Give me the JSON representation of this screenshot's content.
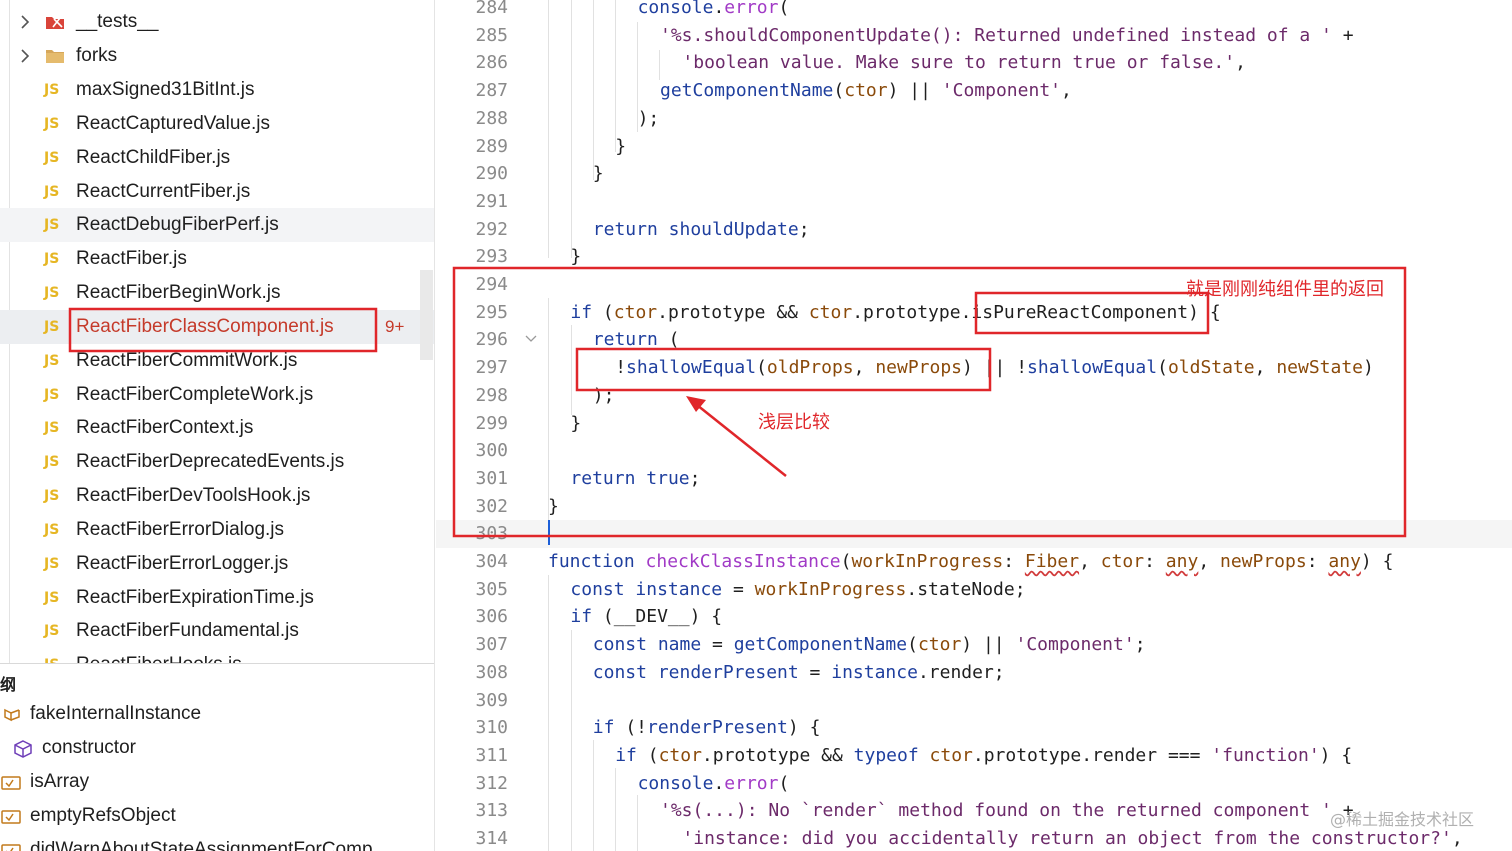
{
  "explorer": {
    "items": [
      {
        "kind": "folder",
        "label": "__tests__",
        "icon": "test-folder-icon"
      },
      {
        "kind": "folder",
        "label": "forks",
        "icon": "folder-icon"
      },
      {
        "kind": "file",
        "label": "maxSigned31BitInt.js"
      },
      {
        "kind": "file",
        "label": "ReactCapturedValue.js"
      },
      {
        "kind": "file",
        "label": "ReactChildFiber.js"
      },
      {
        "kind": "file",
        "label": "ReactCurrentFiber.js"
      },
      {
        "kind": "file",
        "label": "ReactDebugFiberPerf.js"
      },
      {
        "kind": "file",
        "label": "ReactFiber.js"
      },
      {
        "kind": "file",
        "label": "ReactFiberBeginWork.js"
      },
      {
        "kind": "file",
        "label": "ReactFiberClassComponent.js",
        "badge": "9+",
        "selected": true
      },
      {
        "kind": "file",
        "label": "ReactFiberCommitWork.js"
      },
      {
        "kind": "file",
        "label": "ReactFiberCompleteWork.js"
      },
      {
        "kind": "file",
        "label": "ReactFiberContext.js"
      },
      {
        "kind": "file",
        "label": "ReactFiberDeprecatedEvents.js"
      },
      {
        "kind": "file",
        "label": "ReactFiberDevToolsHook.js"
      },
      {
        "kind": "file",
        "label": "ReactFiberErrorDialog.js"
      },
      {
        "kind": "file",
        "label": "ReactFiberErrorLogger.js"
      },
      {
        "kind": "file",
        "label": "ReactFiberExpirationTime.js"
      },
      {
        "kind": "file",
        "label": "ReactFiberFundamental.js"
      },
      {
        "kind": "file",
        "label": "ReactFiberHooks.js"
      }
    ],
    "js_icon_text": "JS",
    "js_icon_color": "#e6b624",
    "modified_color": "#c53a2a"
  },
  "outline": {
    "title": "纲",
    "items": [
      {
        "label": "fakeInternalInstance",
        "icon": "variable-icon"
      },
      {
        "label": "constructor",
        "icon": "method-cube-icon"
      },
      {
        "label": "isArray",
        "icon": "field-icon"
      },
      {
        "label": "emptyRefsObject",
        "icon": "field-icon"
      },
      {
        "label": "didWarnAboutStateAssignmentForComp",
        "icon": "field-icon"
      }
    ]
  },
  "editor": {
    "current_line": 303,
    "lines": [
      {
        "n": "284",
        "indent": 4,
        "tokens": [
          [
            "f",
            "console"
          ],
          [
            "o",
            "."
          ],
          [
            "fn",
            "error"
          ],
          [
            "o",
            "("
          ]
        ]
      },
      {
        "n": "285",
        "indent": 5,
        "tokens": [
          [
            "s",
            "'%s.shouldComponentUpdate(): Returned undefined instead of a '"
          ],
          [
            "o",
            " +"
          ]
        ]
      },
      {
        "n": "286",
        "indent": 6,
        "tokens": [
          [
            "s",
            "'boolean value. Make sure to return true or false.'"
          ],
          [
            "o",
            ","
          ]
        ]
      },
      {
        "n": "287",
        "indent": 5,
        "tokens": [
          [
            "f",
            "getComponentName"
          ],
          [
            "o",
            "("
          ],
          [
            "p",
            "ctor"
          ],
          [
            "o",
            ") || "
          ],
          [
            "s",
            "'Component'"
          ],
          [
            "o",
            ","
          ]
        ]
      },
      {
        "n": "288",
        "indent": 4,
        "tokens": [
          [
            "o",
            ");"
          ]
        ]
      },
      {
        "n": "289",
        "indent": 3,
        "tokens": [
          [
            "o",
            "}"
          ]
        ]
      },
      {
        "n": "290",
        "indent": 2,
        "tokens": [
          [
            "o",
            "}"
          ]
        ]
      },
      {
        "n": "291",
        "indent": 0,
        "tokens": []
      },
      {
        "n": "292",
        "indent": 2,
        "tokens": [
          [
            "k",
            "return"
          ],
          [
            "o",
            " "
          ],
          [
            "v",
            "shouldUpdate"
          ],
          [
            "o",
            ";"
          ]
        ]
      },
      {
        "n": "293",
        "indent": 1,
        "tokens": [
          [
            "o",
            "}"
          ]
        ]
      },
      {
        "n": "294",
        "indent": 0,
        "tokens": []
      },
      {
        "n": "295",
        "indent": 1,
        "tokens": [
          [
            "k",
            "if"
          ],
          [
            "o",
            " ("
          ],
          [
            "p",
            "ctor"
          ],
          [
            "o",
            ".prototype && "
          ],
          [
            "p",
            "ctor"
          ],
          [
            "o",
            ".prototype.isPureReactComponent) {"
          ]
        ]
      },
      {
        "n": "296",
        "indent": 2,
        "fold": true,
        "tokens": [
          [
            "k",
            "return"
          ],
          [
            "o",
            " ("
          ]
        ]
      },
      {
        "n": "297",
        "indent": 3,
        "tokens": [
          [
            "o",
            "!"
          ],
          [
            "f",
            "shallowEqual"
          ],
          [
            "o",
            "("
          ],
          [
            "p",
            "oldProps"
          ],
          [
            "o",
            ", "
          ],
          [
            "p",
            "newProps"
          ],
          [
            "o",
            ") || !"
          ],
          [
            "f",
            "shallowEqual"
          ],
          [
            "o",
            "("
          ],
          [
            "p",
            "oldState"
          ],
          [
            "o",
            ", "
          ],
          [
            "p",
            "newState"
          ],
          [
            "o",
            ")"
          ]
        ]
      },
      {
        "n": "298",
        "indent": 2,
        "tokens": [
          [
            "o",
            ");"
          ]
        ]
      },
      {
        "n": "299",
        "indent": 1,
        "tokens": [
          [
            "o",
            "}"
          ]
        ]
      },
      {
        "n": "300",
        "indent": 0,
        "tokens": []
      },
      {
        "n": "301",
        "indent": 1,
        "tokens": [
          [
            "k",
            "return"
          ],
          [
            "o",
            " "
          ],
          [
            "k",
            "true"
          ],
          [
            "o",
            ";"
          ]
        ]
      },
      {
        "n": "302",
        "indent": 0,
        "tokens": [
          [
            "o",
            "}"
          ]
        ]
      },
      {
        "n": "303",
        "indent": 0,
        "tokens": []
      },
      {
        "n": "304",
        "indent": 0,
        "tokens": [
          [
            "k",
            "function"
          ],
          [
            "o",
            " "
          ],
          [
            "fn",
            "checkClassInstance"
          ],
          [
            "o",
            "("
          ],
          [
            "p",
            "workInProgress"
          ],
          [
            "o",
            ": "
          ],
          [
            "t",
            "Fiber"
          ],
          [
            "o",
            ", "
          ],
          [
            "p",
            "ctor"
          ],
          [
            "o",
            ": "
          ],
          [
            "t",
            "any"
          ],
          [
            "o",
            ", "
          ],
          [
            "p",
            "newProps"
          ],
          [
            "o",
            ": "
          ],
          [
            "t",
            "any"
          ],
          [
            "o",
            ") {"
          ]
        ]
      },
      {
        "n": "305",
        "indent": 1,
        "tokens": [
          [
            "k",
            "const"
          ],
          [
            "o",
            " "
          ],
          [
            "v",
            "instance"
          ],
          [
            "o",
            " = "
          ],
          [
            "p",
            "workInProgress"
          ],
          [
            "o",
            ".stateNode;"
          ]
        ]
      },
      {
        "n": "306",
        "indent": 1,
        "tokens": [
          [
            "k",
            "if"
          ],
          [
            "o",
            " (__DEV__) {"
          ]
        ]
      },
      {
        "n": "307",
        "indent": 2,
        "tokens": [
          [
            "k",
            "const"
          ],
          [
            "o",
            " "
          ],
          [
            "v",
            "name"
          ],
          [
            "o",
            " = "
          ],
          [
            "f",
            "getComponentName"
          ],
          [
            "o",
            "("
          ],
          [
            "p",
            "ctor"
          ],
          [
            "o",
            ") || "
          ],
          [
            "s",
            "'Component'"
          ],
          [
            "o",
            ";"
          ]
        ]
      },
      {
        "n": "308",
        "indent": 2,
        "tokens": [
          [
            "k",
            "const"
          ],
          [
            "o",
            " "
          ],
          [
            "v",
            "renderPresent"
          ],
          [
            "o",
            " = "
          ],
          [
            "v",
            "instance"
          ],
          [
            "o",
            ".render;"
          ]
        ]
      },
      {
        "n": "309",
        "indent": 0,
        "tokens": []
      },
      {
        "n": "310",
        "indent": 2,
        "tokens": [
          [
            "k",
            "if"
          ],
          [
            "o",
            " (!"
          ],
          [
            "v",
            "renderPresent"
          ],
          [
            "o",
            ") {"
          ]
        ]
      },
      {
        "n": "311",
        "indent": 3,
        "tokens": [
          [
            "k",
            "if"
          ],
          [
            "o",
            " ("
          ],
          [
            "p",
            "ctor"
          ],
          [
            "o",
            ".prototype && "
          ],
          [
            "k",
            "typeof"
          ],
          [
            "o",
            " "
          ],
          [
            "p",
            "ctor"
          ],
          [
            "o",
            ".prototype.render === "
          ],
          [
            "s",
            "'function'"
          ],
          [
            "o",
            ") {"
          ]
        ]
      },
      {
        "n": "312",
        "indent": 4,
        "tokens": [
          [
            "f",
            "console"
          ],
          [
            "o",
            "."
          ],
          [
            "fn",
            "error"
          ],
          [
            "o",
            "("
          ]
        ]
      },
      {
        "n": "313",
        "indent": 5,
        "tokens": [
          [
            "s",
            "'%s(...): No `render` method found on the returned component '"
          ],
          [
            "o",
            " +"
          ]
        ]
      },
      {
        "n": "314",
        "indent": 6,
        "tokens": [
          [
            "s",
            "'instance: did you accidentally return an object from the constructor?'"
          ],
          [
            "o",
            ","
          ]
        ]
      }
    ]
  },
  "annotations": {
    "pure_component_note": "就是刚刚纯组件里的返回",
    "shallow_compare_note": "浅层比较",
    "color": "#e0262a"
  },
  "watermark": "@稀土掘金技术社区"
}
